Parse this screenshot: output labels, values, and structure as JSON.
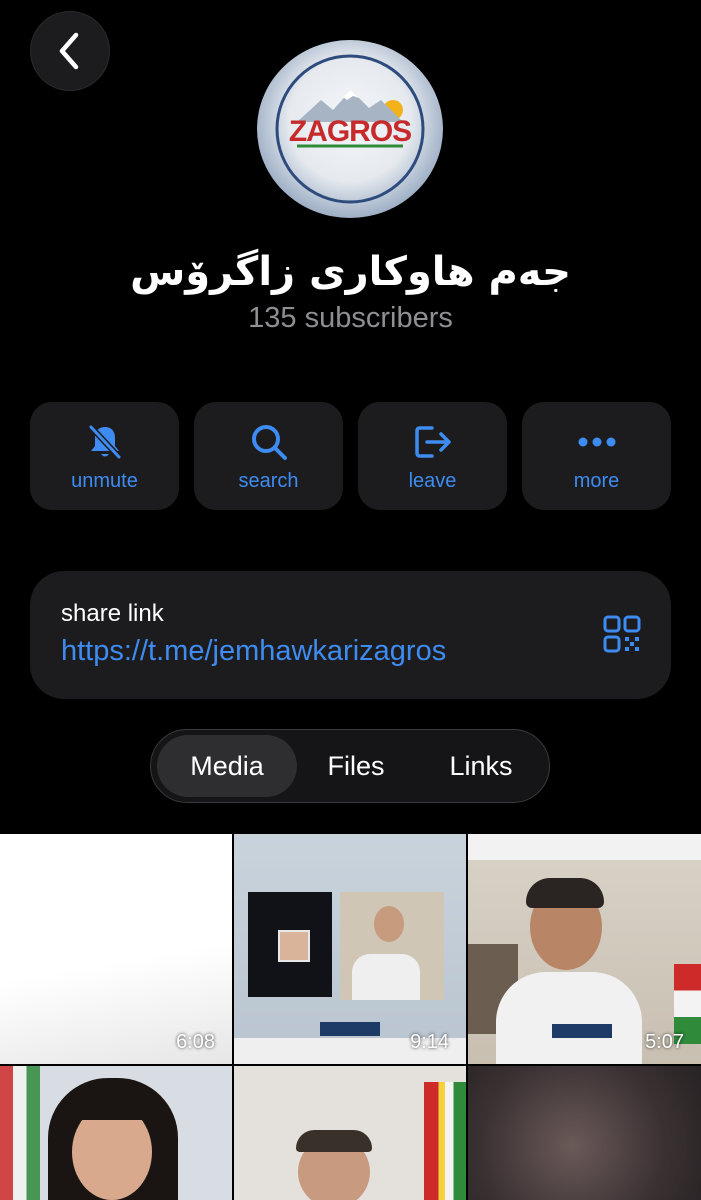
{
  "header": {
    "back_icon": "chevron-left-icon"
  },
  "channel": {
    "avatar_text": "ZAGROS",
    "title": "جەم هاوكاری زاگرۆس",
    "subscribers": "135 subscribers"
  },
  "actions": [
    {
      "label": "unmute",
      "icon": "bell-slash-icon"
    },
    {
      "label": "search",
      "icon": "search-icon"
    },
    {
      "label": "leave",
      "icon": "leave-icon"
    },
    {
      "label": "more",
      "icon": "ellipsis-icon"
    }
  ],
  "share": {
    "title": "share link",
    "url": "https://t.me/jemhawkarizagros",
    "icon": "qr-code-icon"
  },
  "tabs": [
    {
      "label": "Media",
      "selected": true
    },
    {
      "label": "Files",
      "selected": false
    },
    {
      "label": "Links",
      "selected": false
    }
  ],
  "media": [
    {
      "duration": "6:08"
    },
    {
      "duration": "9:14"
    },
    {
      "duration": "5:07"
    },
    {
      "duration": ""
    },
    {
      "duration": ""
    },
    {
      "duration": ""
    }
  ],
  "colors": {
    "accent": "#3e8cf1",
    "background": "#000000",
    "surface": "#1c1c1e",
    "secondary_text": "#8e8e93"
  }
}
